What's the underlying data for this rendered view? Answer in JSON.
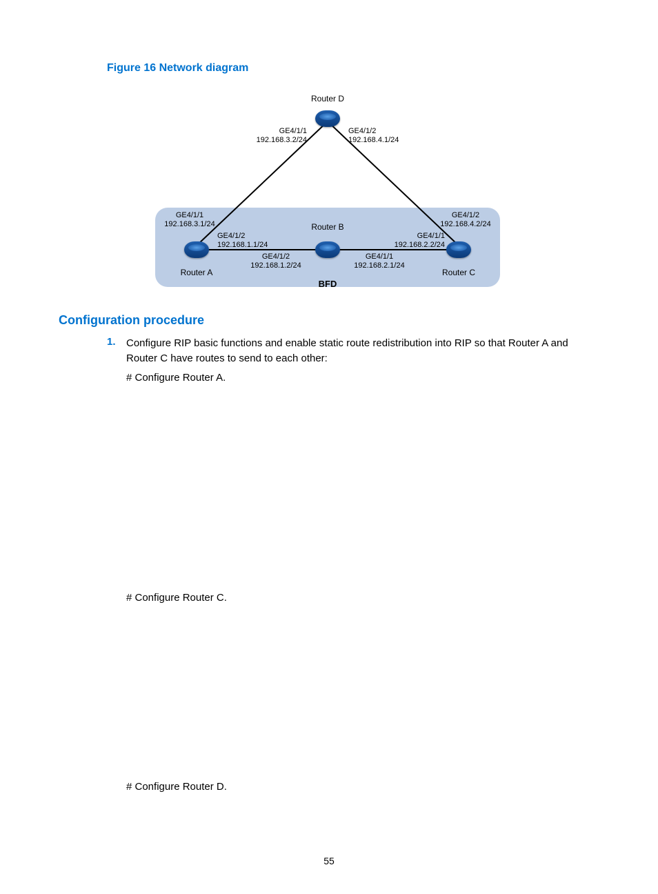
{
  "figure_title": "Figure 16 Network diagram",
  "section_heading": "Configuration procedure",
  "page_number": "55",
  "diagram": {
    "bfd_label": "BFD",
    "routers": {
      "d": {
        "name": "Router D"
      },
      "a": {
        "name": "Router A"
      },
      "b": {
        "name": "Router B"
      },
      "c": {
        "name": "Router C"
      }
    },
    "interfaces": {
      "d_left": "GE4/1/1\n192.168.3.2/24",
      "d_right": "GE4/1/2\n192.168.4.1/24",
      "a_up": "GE4/1/1\n192.168.3.1/24",
      "a_right": "GE4/1/2\n192.168.1.1/24",
      "b_left": "GE4/1/2\n192.168.1.2/24",
      "b_right": "GE4/1/1\n192.168.2.1/24",
      "c_up": "GE4/1/2\n192.168.4.2/24",
      "c_left": "GE4/1/1\n192.168.2.2/24"
    }
  },
  "steps": [
    {
      "num": "1.",
      "intro": "Configure RIP basic functions and enable static route redistribution into RIP so that Router A and Router C have routes to send to each other:",
      "config_a_label": "# Configure Router A.",
      "config_c_label": "# Configure Router C.",
      "config_d_label": "# Configure Router D."
    }
  ]
}
